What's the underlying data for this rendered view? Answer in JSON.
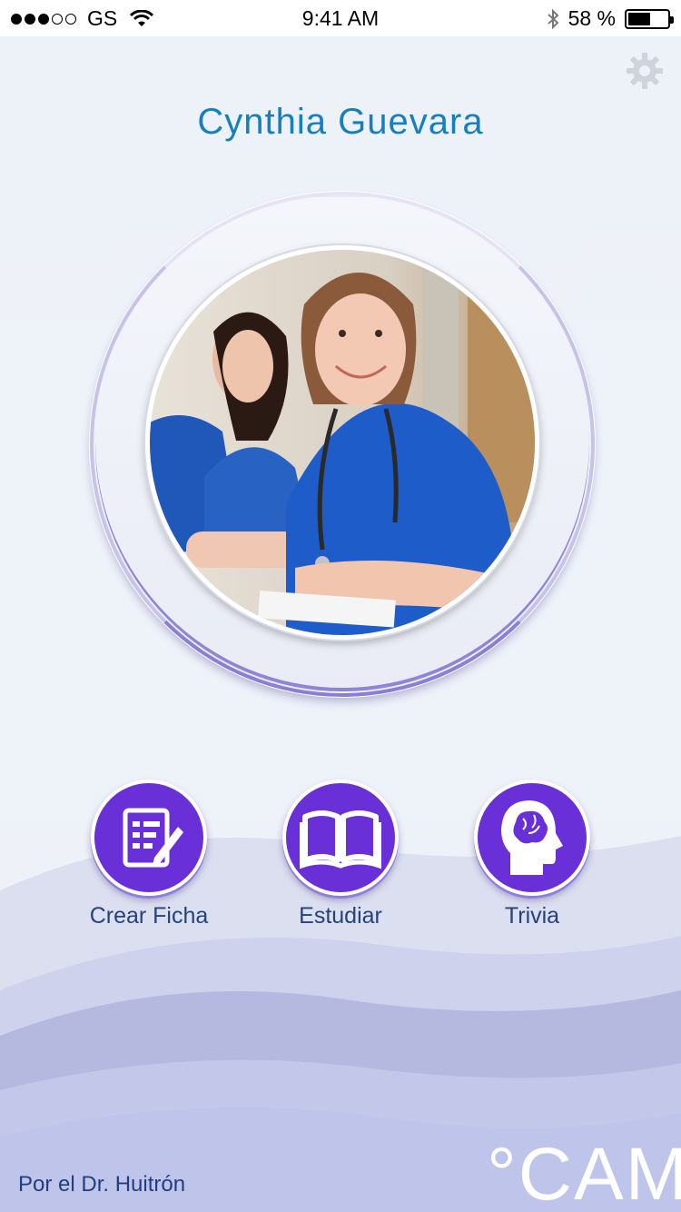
{
  "status_bar": {
    "carrier": "GS",
    "time": "9:41 AM",
    "battery_text": "58 %",
    "battery_level": 0.58,
    "signal_bars_filled": 3,
    "signal_bars_total": 5
  },
  "header": {
    "user_name": "Cynthia Guevara",
    "settings_icon": "gear-icon"
  },
  "avatar": {
    "description_icon": "profile-photo"
  },
  "actions": [
    {
      "label": "Crear Ficha",
      "icon": "note-edit-icon"
    },
    {
      "label": "Estudiar",
      "icon": "open-book-icon"
    },
    {
      "label": "Trivia",
      "icon": "brain-head-icon"
    }
  ],
  "footer": {
    "credit": "Por el Dr. Huitrón",
    "brand": "°CAM"
  },
  "colors": {
    "name": "#1680bf",
    "accent": "#6a30d8",
    "label": "#23437a"
  }
}
